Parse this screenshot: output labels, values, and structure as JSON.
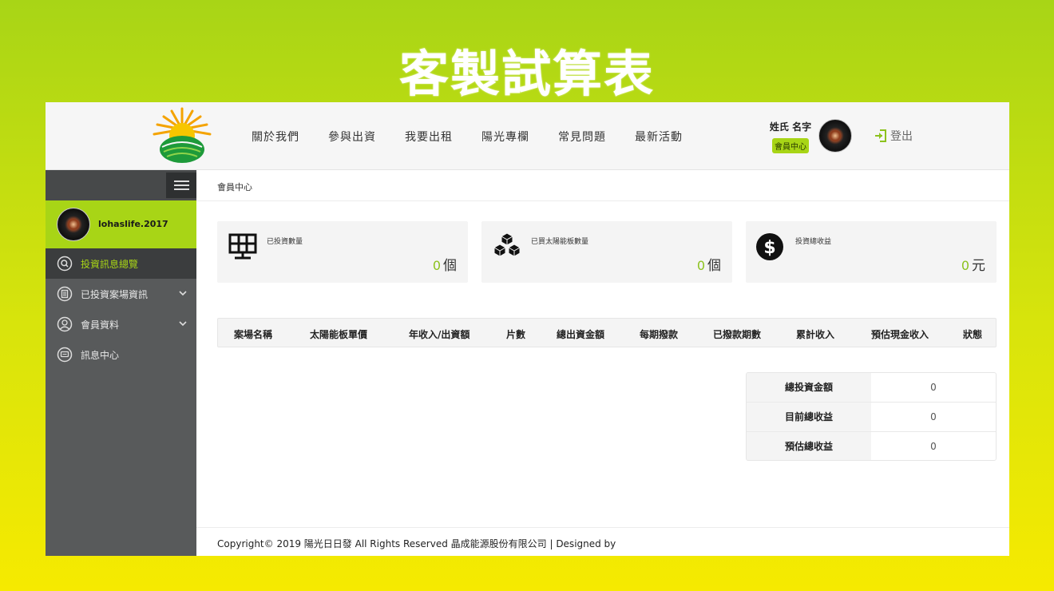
{
  "banner": {
    "title": "客製試算表"
  },
  "header": {
    "nav": [
      "關於我們",
      "參與出資",
      "我要出租",
      "陽光專欄",
      "常見問題",
      "最新活動"
    ],
    "user_name": "姓氏 名字",
    "member_center": "會員中心",
    "logout": "登出"
  },
  "sidebar": {
    "username": "lohaslife.2017",
    "items": [
      {
        "label": "投資訊息總覽",
        "icon": "search-icon",
        "active": true
      },
      {
        "label": "已投資案場資訊",
        "icon": "document-icon",
        "active": false
      },
      {
        "label": "會員資料",
        "icon": "user-icon",
        "active": false
      },
      {
        "label": "訊息中心",
        "icon": "chat-icon",
        "active": false
      }
    ]
  },
  "breadcrumb": "會員中心",
  "stats": [
    {
      "label": "已投資數量",
      "value": "0",
      "unit": "個",
      "icon": "solar-panel-icon"
    },
    {
      "label": "已買太陽能板數量",
      "value": "0",
      "unit": "個",
      "icon": "boxes-icon"
    },
    {
      "label": "投資總收益",
      "value": "0",
      "unit": "元",
      "icon": "dollar-icon"
    }
  ],
  "table": {
    "columns": [
      "案場名稱",
      "太陽能板單價",
      "年收入/出資額",
      "片數",
      "總出資金額",
      "每期撥款",
      "已撥款期數",
      "累計收入",
      "預估現金收入",
      "狀態"
    ]
  },
  "summary": [
    {
      "label": "總投資金額",
      "value": "0"
    },
    {
      "label": "目前總收益",
      "value": "0"
    },
    {
      "label": "預估總收益",
      "value": "0"
    }
  ],
  "footer": "Copyright© 2019 陽光日日發 All Rights Reserved 晶成能源股份有限公司 | Designed by",
  "colors": {
    "accent": "#a8d516",
    "sidebar": "#585a5b",
    "number": "#8cc21e"
  }
}
